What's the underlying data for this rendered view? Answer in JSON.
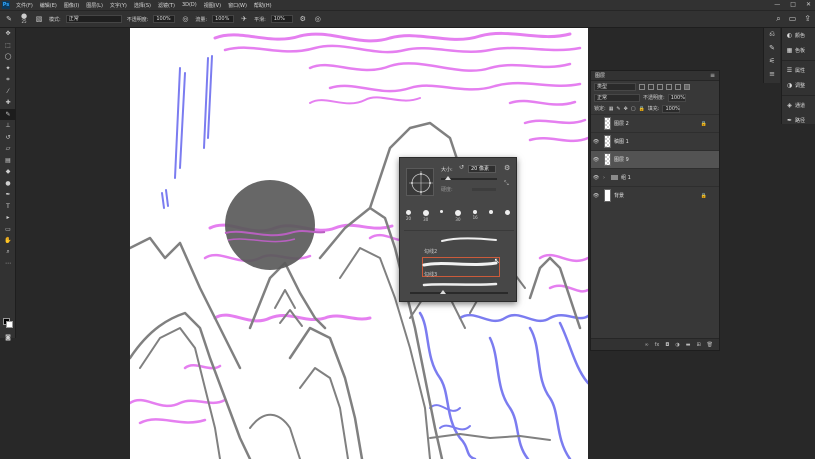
{
  "menubar": {
    "logo": "Ps",
    "items": [
      "文件(F)",
      "编辑(E)",
      "图像(I)",
      "图层(L)",
      "文字(Y)",
      "选择(S)",
      "滤镜(T)",
      "3D(D)",
      "视图(V)",
      "窗口(W)",
      "帮助(H)"
    ],
    "window_controls": [
      "—",
      "□",
      "✕"
    ]
  },
  "options": {
    "brush_size": "25",
    "mode_label": "模式:",
    "mode_value": "正常",
    "opacity_label": "不透明度:",
    "opacity_value": "100%",
    "flow_label": "流量:",
    "flow_value": "100%",
    "smooth_label": "平滑:",
    "smooth_value": "10%"
  },
  "brush_panel": {
    "size_label": "大小:",
    "size_value": "20 像素",
    "hardness_label": "硬度:",
    "presets": [
      {
        "label": "20",
        "d": 5
      },
      {
        "label": "30",
        "d": 6
      },
      {
        "label": "",
        "d": 3
      },
      {
        "label": "30",
        "d": 6
      },
      {
        "label": "16",
        "d": 4
      },
      {
        "label": "",
        "d": 4
      },
      {
        "label": "",
        "d": 5
      }
    ],
    "stroke_labels": [
      "勾线2",
      "勾线3"
    ]
  },
  "layers": {
    "panel_title": "图层",
    "filter_kind": "类型",
    "blend_mode": "正常",
    "opacity_label": "不透明度:",
    "opacity_value": "100%",
    "lock_label": "锁定:",
    "fill_label": "填充:",
    "fill_value": "100%",
    "items": [
      {
        "name": "图层 2",
        "visible": false,
        "locked": true,
        "type": "checker",
        "selected": false
      },
      {
        "name": "稿图 1",
        "visible": true,
        "locked": false,
        "type": "sketch",
        "selected": false
      },
      {
        "name": "图层 9",
        "visible": true,
        "locked": false,
        "type": "checker",
        "selected": true
      },
      {
        "name": "组 1",
        "visible": true,
        "locked": false,
        "type": "group",
        "selected": false
      },
      {
        "name": "背景",
        "visible": true,
        "locked": true,
        "type": "white",
        "selected": false
      }
    ],
    "footer_icons": [
      "link-icon",
      "fx-icon",
      "mask-icon",
      "adjustment-icon",
      "folder-icon",
      "new-layer-icon",
      "trash-icon"
    ]
  },
  "right_dock": {
    "items": [
      {
        "icon": "palette-icon",
        "label": "颜色"
      },
      {
        "icon": "grid-icon",
        "label": "色板"
      },
      {
        "icon": "sliders-icon",
        "label": "属性"
      },
      {
        "icon": "circle-half-icon",
        "label": "调整"
      },
      {
        "icon": "layers-icon",
        "label": "通道"
      },
      {
        "icon": "path-icon",
        "label": "路径"
      }
    ]
  },
  "colors": {
    "accent": "#31a8ff",
    "selection_border": "#cc5b3b",
    "canvas": "#ffffff",
    "pink_strokes": "#e57ff0",
    "blue_strokes": "#7b7cf0",
    "gray_strokes": "#808080"
  }
}
